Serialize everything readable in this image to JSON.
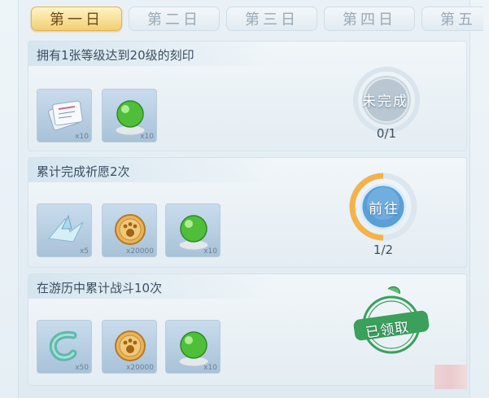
{
  "tabs": [
    {
      "label": "第一日",
      "active": true
    },
    {
      "label": "第二日",
      "active": false
    },
    {
      "label": "第三日",
      "active": false
    },
    {
      "label": "第四日",
      "active": false
    },
    {
      "label": "第五",
      "active": false
    }
  ],
  "tasks": [
    {
      "title": "拥有1张等级达到20级的刻印",
      "rewards": [
        {
          "icon": "scroll-stack-icon",
          "qty": "x10"
        },
        {
          "icon": "green-orb-icon",
          "qty": "x10"
        }
      ],
      "status_label": "未完成",
      "progress": "0/1",
      "progress_fraction": 0
    },
    {
      "title": "累计完成祈愿2次",
      "rewards": [
        {
          "icon": "crystal-crane-icon",
          "qty": "x5"
        },
        {
          "icon": "paw-coin-icon",
          "qty": "x20000"
        },
        {
          "icon": "green-orb-icon",
          "qty": "x10"
        }
      ],
      "status_label": "前往",
      "progress": "1/2",
      "progress_fraction": 0.5
    },
    {
      "title": "在游历中累计战斗10次",
      "rewards": [
        {
          "icon": "jade-hook-icon",
          "qty": "x50"
        },
        {
          "icon": "paw-coin-icon",
          "qty": "x20000"
        },
        {
          "icon": "green-orb-icon",
          "qty": "x10"
        }
      ],
      "status_label": "已领取"
    }
  ],
  "colors": {
    "active_tab": "#f2cf74",
    "progress_arc": "#f4b24a",
    "claimed_green": "#3aa05a"
  }
}
